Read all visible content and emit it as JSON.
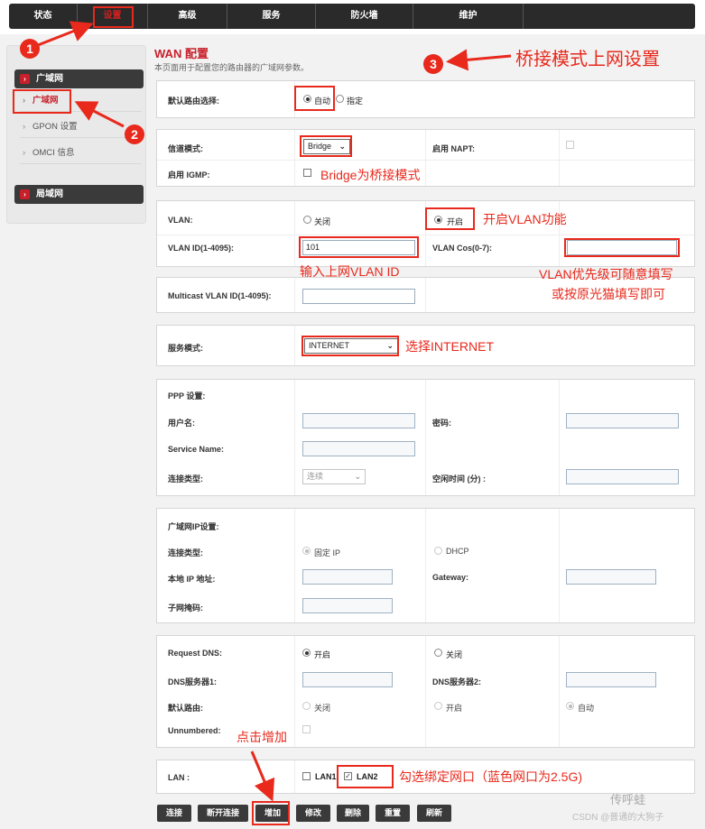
{
  "nav": {
    "tabs": [
      "状态",
      "设置",
      "高级",
      "服务",
      "防火墙",
      "维护"
    ],
    "active": 1
  },
  "sidebar": {
    "sections": [
      {
        "label": "广域网",
        "items": [
          "广域网",
          "GPON 设置",
          "OMCI 信息"
        ]
      },
      {
        "label": "局域网"
      }
    ]
  },
  "page": {
    "title": "WAN 配置",
    "subtitle": "本页面用于配置您的路由器的广域网参数。"
  },
  "form": {
    "route": {
      "label": "默认路由选择:",
      "opt_auto": "自动",
      "opt_specify": "指定",
      "selected": "自动"
    },
    "mode": {
      "label": "信道模式:",
      "value": "Bridge",
      "nat_label": "启用 NAPT:",
      "igmp_label": "启用 IGMP:"
    },
    "vlan": {
      "label": "VLAN:",
      "opt_off": "关闭",
      "opt_on": "开启",
      "selected": "开启",
      "id_label": "VLAN ID(1-4095):",
      "id_value": "101",
      "cos_label": "VLAN Cos(0-7):",
      "cos_value": "",
      "mcast_label": "Multicast VLAN ID(1-4095):",
      "mcast_value": ""
    },
    "service": {
      "label": "服务模式:",
      "value": "INTERNET"
    },
    "ppp": {
      "title": "PPP 设置:",
      "user_label": "用户名:",
      "pwd_label": "密码:",
      "svc_label": "Service Name:",
      "conn_label": "连接类型:",
      "conn_value": "连续",
      "idle_label": "空闲时间 (分) :"
    },
    "wanip": {
      "title": "广域网IP设置:",
      "conn_label": "连接类型:",
      "opt_fixed": "固定 IP",
      "opt_dhcp": "DHCP",
      "local_label": "本地 IP 地址:",
      "gw_label": "Gateway:",
      "mask_label": "子网掩码:"
    },
    "dns": {
      "req_label": "Request DNS:",
      "opt_on": "开启",
      "opt_off": "关闭",
      "dns1_label": "DNS服务器1:",
      "dns2_label": "DNS服务器2:",
      "droute_label": "默认路由:",
      "dr_off": "关闭",
      "dr_on": "开启",
      "dr_auto": "自动",
      "unnum_label": "Unnumbered:"
    },
    "lan": {
      "label": "LAN :",
      "lan1": "LAN1",
      "lan2": "LAN2",
      "lan1_checked": false,
      "lan2_checked": true
    }
  },
  "buttons": [
    "连接",
    "断开连接",
    "增加",
    "修改",
    "删除",
    "重置",
    "刷新"
  ],
  "annotations": {
    "n1": "1",
    "n2": "2",
    "n3": "3",
    "title": "桥接模式上网设置",
    "bridge": "Bridge为桥接模式",
    "vlan_on": "开启VLAN功能",
    "vlan_id": "输入上网VLAN ID",
    "cos1": "VLAN优先级可随意填写",
    "cos2": "或按原光猫填写即可",
    "internet": "选择INTERNET",
    "add": "点击增加",
    "lan": "勾选绑定网口（蓝色网口为2.5G)"
  },
  "watermark": {
    "wechat": "传呼蛙",
    "csdn": "CSDN @普通的大狗子"
  },
  "colors": {
    "accent": "#c8202b",
    "annotation": "#e8291c",
    "nav_bg": "#2a2a2a"
  }
}
